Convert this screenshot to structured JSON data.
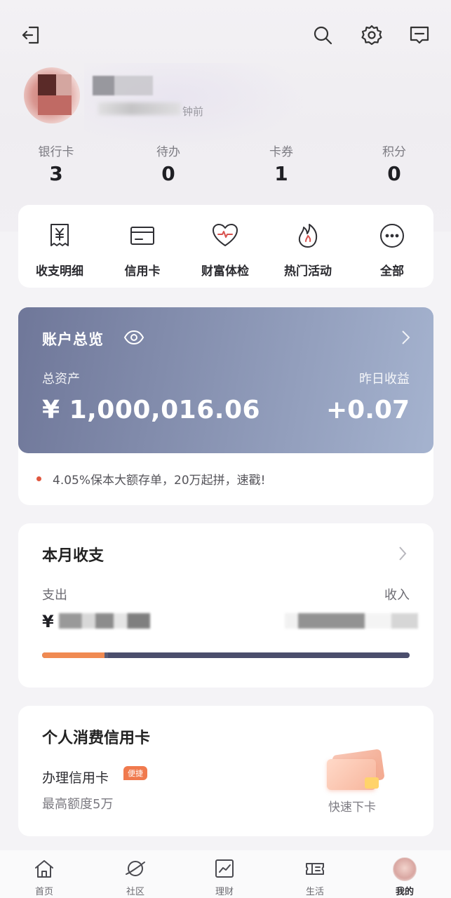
{
  "header": {
    "login_time": "钟前"
  },
  "icons": {
    "logout": "logout-icon",
    "search": "search-icon",
    "settings": "gear-icon",
    "message": "message-icon"
  },
  "stats": [
    {
      "label": "银行卡",
      "value": "3"
    },
    {
      "label": "待办",
      "value": "0"
    },
    {
      "label": "卡券",
      "value": "1"
    },
    {
      "label": "积分",
      "value": "0"
    }
  ],
  "quick_menu": [
    {
      "label": "收支明细",
      "icon": "receipt-icon"
    },
    {
      "label": "信用卡",
      "icon": "credit-card-icon"
    },
    {
      "label": "财富体检",
      "icon": "heart-pulse-icon"
    },
    {
      "label": "热门活动",
      "icon": "flame-icon"
    },
    {
      "label": "全部",
      "icon": "more-dots-icon"
    }
  ],
  "account": {
    "title": "账户总览",
    "total_label": "总资产",
    "yesterday_label": "昨日收益",
    "total_value": "¥ 1,000,016.06",
    "yesterday_value": "+0.07",
    "gradient_start": "#6f7799",
    "gradient_end": "#a5b3cf"
  },
  "promo": {
    "text": "4.05%保本大额存单，20万起拼，速戳!",
    "dot_color": "#e0573f"
  },
  "monthly": {
    "title": "本月收支",
    "expense_label": "支出",
    "income_label": "收入",
    "expense_prefix": "¥",
    "expense_share": 0.17,
    "expense_color": "#f08a52",
    "income_color": "#4b4e6c"
  },
  "credit": {
    "title": "个人消费信用卡",
    "product": "办理信用卡",
    "badge": "便捷",
    "limit": "最高额度5万",
    "cta": "快速下卡"
  },
  "tabbar": [
    {
      "label": "首页",
      "icon": "home-icon"
    },
    {
      "label": "社区",
      "icon": "planet-icon"
    },
    {
      "label": "理财",
      "icon": "chart-icon"
    },
    {
      "label": "生活",
      "icon": "ticket-icon"
    },
    {
      "label": "我的",
      "icon": "avatar"
    }
  ]
}
